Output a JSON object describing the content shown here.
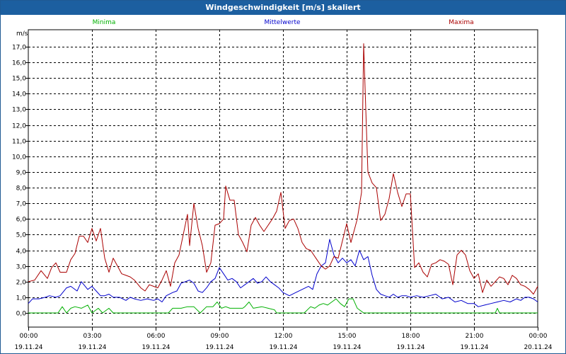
{
  "window": {
    "title": "Windgeschwindigkeit [m/s] skaliert"
  },
  "chart_data": {
    "type": "line",
    "title": "Windgeschwindigkeit [m/s] skaliert",
    "ylabel": "m/s",
    "ylim": [
      -1,
      18
    ],
    "xlim_hours": [
      0,
      24
    ],
    "grid": true,
    "legend_placement": "top",
    "y_ticks": [
      "0,0",
      "1,0",
      "2,0",
      "3,0",
      "4,0",
      "5,0",
      "6,0",
      "7,0",
      "8,0",
      "9,0",
      "10,0",
      "11,0",
      "12,0",
      "13,0",
      "14,0",
      "15,0",
      "16,0",
      "17,0"
    ],
    "x_ticks": [
      {
        "time": "00:00",
        "date": "19.11.24"
      },
      {
        "time": "03:00",
        "date": "19.11.24"
      },
      {
        "time": "06:00",
        "date": "19.11.24"
      },
      {
        "time": "09:00",
        "date": "19.11.24"
      },
      {
        "time": "12:00",
        "date": "19.11.24"
      },
      {
        "time": "15:00",
        "date": "19.11.24"
      },
      {
        "time": "18:00",
        "date": "19.11.24"
      },
      {
        "time": "21:00",
        "date": "19.11.24"
      },
      {
        "time": "00:00",
        "date": "20.11.24"
      }
    ],
    "series": [
      {
        "name": "Minima",
        "color": "#00b000",
        "points": [
          [
            0,
            0.0
          ],
          [
            1.4,
            0.0
          ],
          [
            1.6,
            0.4
          ],
          [
            1.8,
            0.0
          ],
          [
            2.0,
            0.3
          ],
          [
            2.2,
            0.4
          ],
          [
            2.5,
            0.3
          ],
          [
            2.8,
            0.5
          ],
          [
            3.0,
            0.0
          ],
          [
            3.3,
            0.3
          ],
          [
            3.5,
            0.0
          ],
          [
            3.8,
            0.3
          ],
          [
            4.0,
            0.0
          ],
          [
            6.6,
            0.0
          ],
          [
            6.8,
            0.3
          ],
          [
            7.2,
            0.3
          ],
          [
            7.5,
            0.4
          ],
          [
            7.8,
            0.4
          ],
          [
            8.1,
            0.0
          ],
          [
            8.4,
            0.4
          ],
          [
            8.7,
            0.4
          ],
          [
            8.9,
            0.7
          ],
          [
            9.1,
            0.3
          ],
          [
            9.3,
            0.4
          ],
          [
            9.5,
            0.3
          ],
          [
            10.1,
            0.3
          ],
          [
            10.2,
            0.4
          ],
          [
            10.4,
            0.7
          ],
          [
            10.6,
            0.3
          ],
          [
            11.0,
            0.4
          ],
          [
            11.3,
            0.3
          ],
          [
            11.6,
            0.2
          ],
          [
            11.7,
            0.0
          ],
          [
            13.0,
            0.0
          ],
          [
            13.3,
            0.4
          ],
          [
            13.5,
            0.3
          ],
          [
            13.7,
            0.5
          ],
          [
            13.9,
            0.6
          ],
          [
            14.1,
            0.5
          ],
          [
            14.3,
            0.7
          ],
          [
            14.5,
            0.9
          ],
          [
            14.7,
            0.6
          ],
          [
            14.9,
            0.4
          ],
          [
            15.1,
            0.9
          ],
          [
            15.3,
            0.9
          ],
          [
            15.5,
            0.3
          ],
          [
            15.8,
            0.0
          ],
          [
            22.0,
            0.0
          ],
          [
            22.1,
            0.3
          ],
          [
            22.2,
            0.0
          ],
          [
            24.0,
            0.0
          ]
        ]
      },
      {
        "name": "Mittelwerte",
        "color": "#0000cc",
        "points": [
          [
            0,
            0.6
          ],
          [
            0.2,
            0.9
          ],
          [
            0.5,
            0.9
          ],
          [
            0.8,
            1.0
          ],
          [
            1.0,
            1.1
          ],
          [
            1.3,
            1.0
          ],
          [
            1.5,
            1.1
          ],
          [
            1.8,
            1.6
          ],
          [
            2.0,
            1.7
          ],
          [
            2.3,
            1.4
          ],
          [
            2.5,
            2.0
          ],
          [
            2.8,
            1.5
          ],
          [
            3.0,
            1.7
          ],
          [
            3.2,
            1.4
          ],
          [
            3.4,
            1.1
          ],
          [
            3.6,
            1.1
          ],
          [
            3.8,
            1.2
          ],
          [
            4.0,
            1.0
          ],
          [
            4.3,
            1.0
          ],
          [
            4.6,
            0.8
          ],
          [
            4.8,
            1.0
          ],
          [
            5.0,
            0.9
          ],
          [
            5.3,
            0.8
          ],
          [
            5.6,
            0.9
          ],
          [
            5.9,
            0.8
          ],
          [
            6.1,
            0.9
          ],
          [
            6.3,
            0.7
          ],
          [
            6.5,
            1.1
          ],
          [
            6.8,
            1.3
          ],
          [
            7.0,
            1.4
          ],
          [
            7.2,
            1.9
          ],
          [
            7.4,
            2.0
          ],
          [
            7.6,
            2.1
          ],
          [
            7.8,
            1.9
          ],
          [
            8.0,
            1.4
          ],
          [
            8.2,
            1.3
          ],
          [
            8.4,
            1.6
          ],
          [
            8.6,
            2.0
          ],
          [
            8.8,
            2.2
          ],
          [
            9.0,
            2.9
          ],
          [
            9.2,
            2.5
          ],
          [
            9.4,
            2.1
          ],
          [
            9.6,
            2.2
          ],
          [
            9.8,
            2.0
          ],
          [
            10.0,
            1.6
          ],
          [
            10.2,
            1.8
          ],
          [
            10.4,
            2.0
          ],
          [
            10.6,
            2.2
          ],
          [
            10.8,
            1.9
          ],
          [
            11.0,
            2.0
          ],
          [
            11.2,
            2.3
          ],
          [
            11.4,
            2.0
          ],
          [
            11.6,
            1.8
          ],
          [
            11.8,
            1.6
          ],
          [
            12.0,
            1.3
          ],
          [
            12.3,
            1.1
          ],
          [
            12.6,
            1.3
          ],
          [
            12.9,
            1.5
          ],
          [
            13.2,
            1.7
          ],
          [
            13.4,
            1.5
          ],
          [
            13.6,
            2.5
          ],
          [
            13.8,
            3.0
          ],
          [
            14.0,
            3.2
          ],
          [
            14.2,
            4.7
          ],
          [
            14.4,
            3.7
          ],
          [
            14.6,
            3.2
          ],
          [
            14.8,
            3.5
          ],
          [
            15.0,
            3.2
          ],
          [
            15.2,
            3.4
          ],
          [
            15.4,
            3.0
          ],
          [
            15.6,
            4.0
          ],
          [
            15.8,
            3.4
          ],
          [
            16.0,
            3.6
          ],
          [
            16.2,
            2.4
          ],
          [
            16.4,
            1.5
          ],
          [
            16.6,
            1.2
          ],
          [
            16.8,
            1.1
          ],
          [
            17.0,
            1.0
          ],
          [
            17.2,
            1.2
          ],
          [
            17.4,
            1.0
          ],
          [
            17.6,
            1.1
          ],
          [
            17.8,
            1.1
          ],
          [
            18.0,
            1.0
          ],
          [
            18.3,
            1.1
          ],
          [
            18.6,
            1.0
          ],
          [
            18.9,
            1.1
          ],
          [
            19.2,
            1.2
          ],
          [
            19.5,
            0.9
          ],
          [
            19.8,
            1.0
          ],
          [
            20.1,
            0.7
          ],
          [
            20.4,
            0.8
          ],
          [
            20.7,
            0.6
          ],
          [
            21.0,
            0.6
          ],
          [
            21.2,
            0.4
          ],
          [
            21.5,
            0.5
          ],
          [
            21.8,
            0.6
          ],
          [
            22.1,
            0.7
          ],
          [
            22.4,
            0.8
          ],
          [
            22.7,
            0.7
          ],
          [
            23.0,
            0.9
          ],
          [
            23.2,
            0.8
          ],
          [
            23.4,
            1.0
          ],
          [
            23.6,
            1.0
          ],
          [
            23.8,
            0.9
          ],
          [
            24.0,
            0.7
          ]
        ]
      },
      {
        "name": "Maxima",
        "color": "#aa0000",
        "points": [
          [
            0,
            2.0
          ],
          [
            0.3,
            2.1
          ],
          [
            0.6,
            2.7
          ],
          [
            0.9,
            2.2
          ],
          [
            1.1,
            2.9
          ],
          [
            1.3,
            3.2
          ],
          [
            1.5,
            2.6
          ],
          [
            1.8,
            2.6
          ],
          [
            2.0,
            3.4
          ],
          [
            2.2,
            3.8
          ],
          [
            2.4,
            4.9
          ],
          [
            2.6,
            4.9
          ],
          [
            2.8,
            4.5
          ],
          [
            3.0,
            5.4
          ],
          [
            3.2,
            4.6
          ],
          [
            3.4,
            5.4
          ],
          [
            3.6,
            3.5
          ],
          [
            3.8,
            2.6
          ],
          [
            4.0,
            3.5
          ],
          [
            4.2,
            3.0
          ],
          [
            4.4,
            2.5
          ],
          [
            4.6,
            2.4
          ],
          [
            4.8,
            2.3
          ],
          [
            5.0,
            2.1
          ],
          [
            5.3,
            1.6
          ],
          [
            5.5,
            1.4
          ],
          [
            5.7,
            1.8
          ],
          [
            5.9,
            1.7
          ],
          [
            6.1,
            1.6
          ],
          [
            6.3,
            2.1
          ],
          [
            6.5,
            2.7
          ],
          [
            6.7,
            1.7
          ],
          [
            6.9,
            3.2
          ],
          [
            7.1,
            3.7
          ],
          [
            7.3,
            5.0
          ],
          [
            7.5,
            6.3
          ],
          [
            7.6,
            4.3
          ],
          [
            7.8,
            7.0
          ],
          [
            8.0,
            5.4
          ],
          [
            8.2,
            4.3
          ],
          [
            8.4,
            2.6
          ],
          [
            8.6,
            3.2
          ],
          [
            8.8,
            5.6
          ],
          [
            9.0,
            5.7
          ],
          [
            9.2,
            6.0
          ],
          [
            9.3,
            8.1
          ],
          [
            9.5,
            7.2
          ],
          [
            9.7,
            7.2
          ],
          [
            9.9,
            5.0
          ],
          [
            10.1,
            4.5
          ],
          [
            10.3,
            3.9
          ],
          [
            10.5,
            5.6
          ],
          [
            10.7,
            6.1
          ],
          [
            10.9,
            5.6
          ],
          [
            11.1,
            5.2
          ],
          [
            11.3,
            5.6
          ],
          [
            11.5,
            6.0
          ],
          [
            11.7,
            6.5
          ],
          [
            11.9,
            7.7
          ],
          [
            12.1,
            5.4
          ],
          [
            12.3,
            5.9
          ],
          [
            12.5,
            6.0
          ],
          [
            12.7,
            5.4
          ],
          [
            12.9,
            4.5
          ],
          [
            13.1,
            4.1
          ],
          [
            13.3,
            4.0
          ],
          [
            13.6,
            3.4
          ],
          [
            13.8,
            3.0
          ],
          [
            14.0,
            2.8
          ],
          [
            14.2,
            3.0
          ],
          [
            14.4,
            3.6
          ],
          [
            14.6,
            3.5
          ],
          [
            14.8,
            4.6
          ],
          [
            15.0,
            5.7
          ],
          [
            15.2,
            4.5
          ],
          [
            15.4,
            5.5
          ],
          [
            15.5,
            6.0
          ],
          [
            15.7,
            7.7
          ],
          [
            15.8,
            17.2
          ],
          [
            15.9,
            13.0
          ],
          [
            16.0,
            9.0
          ],
          [
            16.2,
            8.3
          ],
          [
            16.4,
            8.0
          ],
          [
            16.6,
            5.9
          ],
          [
            16.8,
            6.3
          ],
          [
            17.0,
            7.3
          ],
          [
            17.2,
            8.9
          ],
          [
            17.4,
            7.7
          ],
          [
            17.6,
            6.8
          ],
          [
            17.8,
            7.6
          ],
          [
            18.0,
            7.6
          ],
          [
            18.2,
            2.9
          ],
          [
            18.4,
            3.2
          ],
          [
            18.6,
            2.6
          ],
          [
            18.8,
            2.3
          ],
          [
            19.0,
            3.1
          ],
          [
            19.2,
            3.2
          ],
          [
            19.4,
            3.4
          ],
          [
            19.6,
            3.3
          ],
          [
            19.8,
            3.1
          ],
          [
            20.0,
            1.8
          ],
          [
            20.2,
            3.7
          ],
          [
            20.4,
            4.0
          ],
          [
            20.6,
            3.7
          ],
          [
            20.8,
            2.7
          ],
          [
            21.0,
            2.2
          ],
          [
            21.2,
            2.5
          ],
          [
            21.4,
            1.3
          ],
          [
            21.6,
            2.1
          ],
          [
            21.8,
            1.7
          ],
          [
            22.0,
            2.0
          ],
          [
            22.2,
            2.3
          ],
          [
            22.4,
            2.2
          ],
          [
            22.6,
            1.8
          ],
          [
            22.8,
            2.4
          ],
          [
            23.0,
            2.2
          ],
          [
            23.2,
            1.8
          ],
          [
            23.4,
            1.7
          ],
          [
            23.6,
            1.5
          ],
          [
            23.8,
            1.2
          ],
          [
            24.0,
            1.7
          ]
        ]
      }
    ]
  }
}
